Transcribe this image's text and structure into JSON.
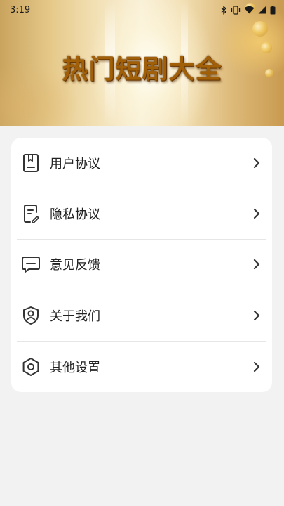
{
  "status_bar": {
    "time": "3:19",
    "icons": [
      "bluetooth-icon",
      "vibrate-icon",
      "wifi-icon",
      "signal-icon",
      "battery-icon"
    ]
  },
  "banner": {
    "title": "热门短剧大全"
  },
  "menu": {
    "items": [
      {
        "label": "用户协议",
        "icon": "user-agreement-icon"
      },
      {
        "label": "隐私协议",
        "icon": "privacy-policy-icon"
      },
      {
        "label": "意见反馈",
        "icon": "feedback-icon"
      },
      {
        "label": "关于我们",
        "icon": "about-us-icon"
      },
      {
        "label": "其他设置",
        "icon": "settings-icon"
      }
    ]
  },
  "colors": {
    "page_background": "#f2f2f2",
    "card_background": "#ffffff",
    "title_gold": "#a15f08",
    "text": "#222222"
  }
}
